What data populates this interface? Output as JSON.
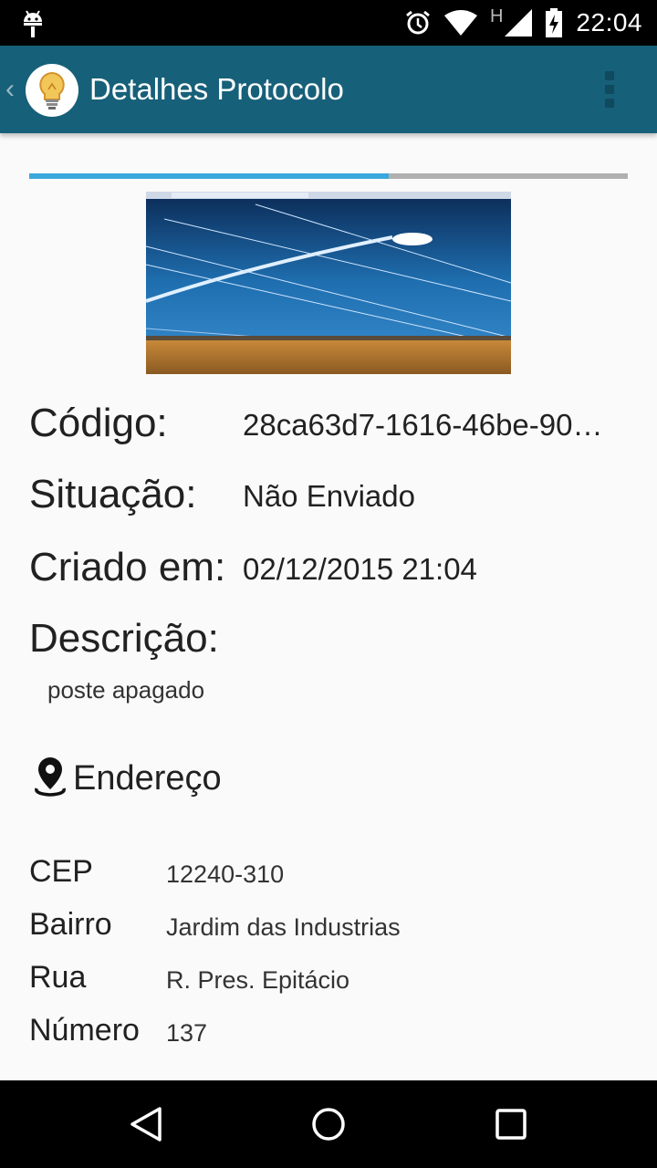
{
  "status_bar": {
    "time": "22:04",
    "network_label": "H",
    "icons": [
      "android-debug-icon",
      "alarm-icon",
      "wifi-icon",
      "cell-signal-icon",
      "battery-charging-icon"
    ]
  },
  "app_bar": {
    "title": "Detalhes Protocolo",
    "back_glyph": "‹",
    "icons": [
      "back-chevron-icon",
      "lightbulb-logo-icon",
      "overflow-menu-icon"
    ],
    "background_color": "#176079"
  },
  "progress": {
    "fraction": 0.6,
    "fill_color": "#3aa8dc",
    "track_color": "#b0b0b0"
  },
  "photo": {
    "subject": "street-light-photo"
  },
  "details": {
    "codigo_label": "Código:",
    "codigo_value": "28ca63d7-1616-46be-90…",
    "situacao_label": "Situação:",
    "situacao_value": "Não Enviado",
    "criado_label": "Criado em:",
    "criado_value": "02/12/2015 21:04",
    "descricao_label": "Descrição:",
    "descricao_value": "poste apagado"
  },
  "endereco": {
    "title": "Endereço",
    "icon": "location-pin-icon",
    "fields": [
      {
        "label": "CEP",
        "value": "12240-310"
      },
      {
        "label": "Bairro",
        "value": "Jardim das Industrias"
      },
      {
        "label": "Rua",
        "value": "R. Pres. Epitácio"
      },
      {
        "label": "Número",
        "value": "137"
      }
    ]
  },
  "nav_bar": {
    "icons": [
      "nav-back-icon",
      "nav-home-icon",
      "nav-recents-icon"
    ]
  }
}
